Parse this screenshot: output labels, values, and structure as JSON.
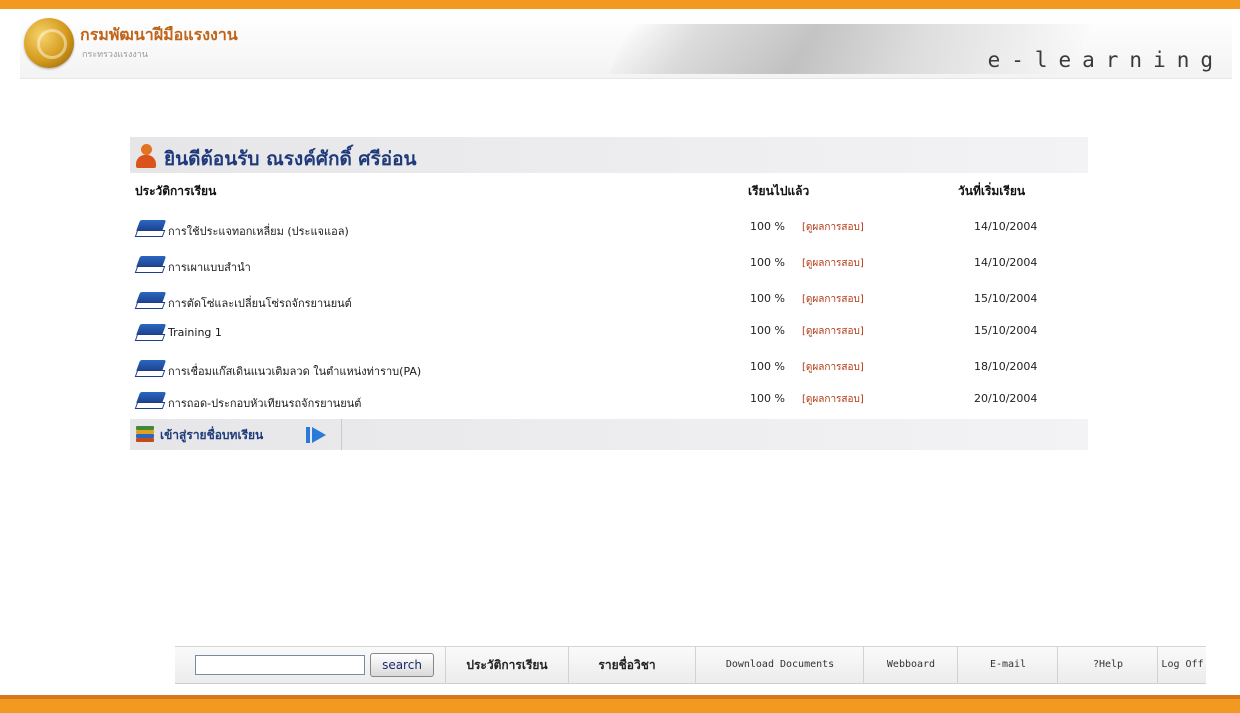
{
  "header": {
    "org_name": "กรมพัฒนาฝีมือแรงงาน",
    "org_sub": "กระทรวงแรงงาน",
    "tagline": "e-learning"
  },
  "welcome": {
    "text": "ยินดีต้อนรับ ณรงค์ศักดิ์ ศรีอ่อน"
  },
  "table": {
    "headers": {
      "history": "ประวัติการเรียน",
      "progress": "เรียนไปแล้ว",
      "start_date": "วันที่เริ่มเรียน"
    },
    "rows": [
      {
        "course": "การใช้ประแจทอกเหลี่ยม (ประแจแอล)",
        "percent": "100 %",
        "result": "[ดูผลการสอบ]",
        "date": "14/10/2004"
      },
      {
        "course": "การเผาแบบสำนำ",
        "percent": "100 %",
        "result": "[ดูผลการสอบ]",
        "date": "14/10/2004"
      },
      {
        "course": "การตัดโซ่และเปลี่ยนโซ่รถจักรยานยนต์",
        "percent": "100 %",
        "result": "[ดูผลการสอบ]",
        "date": "15/10/2004"
      },
      {
        "course": "Training 1",
        "percent": "100 %",
        "result": "[ดูผลการสอบ]",
        "date": "15/10/2004"
      },
      {
        "course": "การเชื่อมแก๊สเดินแนวเติมลวด ในตำแหน่งท่าราบ(PA)",
        "percent": "100 %",
        "result": "[ดูผลการสอบ]",
        "date": "18/10/2004"
      },
      {
        "course": "การถอด-ประกอบหัวเทียนรถจักรยานยนต์",
        "percent": "100 %",
        "result": "[ดูผลการสอบ]",
        "date": "20/10/2004"
      }
    ]
  },
  "enter_list": {
    "label": "เข้าสู่รายชื่อบทเรียน"
  },
  "footer": {
    "search_value": "",
    "search_button": "search",
    "nav": {
      "history": "ประวัติการเรียน",
      "subjects": "รายชื่อวิชา",
      "download": "Download Documents",
      "webboard": "Webboard",
      "email": "E-mail",
      "help": "?Help",
      "logoff": "Log Off"
    }
  },
  "colors": {
    "orange": "#f29a1f",
    "link_red": "#b23a12",
    "title_blue": "#1f3a7a"
  },
  "icons": {
    "user": "user-icon",
    "book": "book-icon",
    "stack": "book-stack-icon",
    "play": "play-arrow-icon"
  }
}
